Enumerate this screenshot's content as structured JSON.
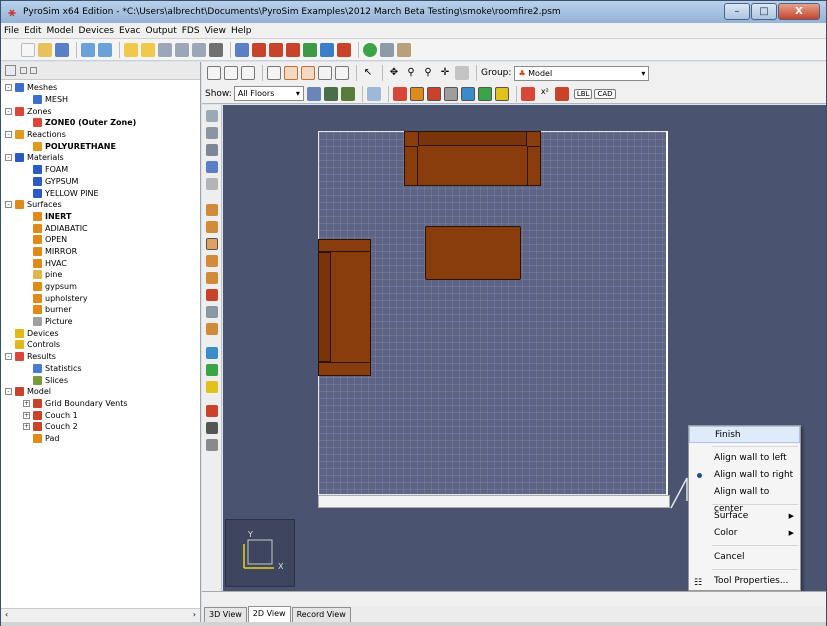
{
  "window": {
    "title": "PyroSim x64 Edition - *C:\\Users\\albrecht\\Documents\\PyroSim Examples\\2012 March Beta Testing\\smoke\\roomfire2.psm",
    "minimize": "–",
    "maximize": "□",
    "close": "X"
  },
  "menu": [
    "File",
    "Edit",
    "Model",
    "Devices",
    "Evac",
    "Output",
    "FDS",
    "View",
    "Help"
  ],
  "toolbar": {
    "group_label": "Group:",
    "group_value": "Model",
    "show_label": "Show:",
    "show_value": "All Floors",
    "lbl_button": "LBL",
    "cad_button": "CAD"
  },
  "tree": [
    {
      "label": "Meshes",
      "indent": 0,
      "toggle": "-",
      "icon_color": "#3b6fc9",
      "bold": false
    },
    {
      "label": "MESH",
      "indent": 1,
      "toggle": "",
      "icon_color": "#3b6fc9",
      "bold": false
    },
    {
      "label": "Zones",
      "indent": 0,
      "toggle": "-",
      "icon_color": "#d9463a",
      "bold": false
    },
    {
      "label": "ZONE0 (Outer Zone)",
      "indent": 1,
      "toggle": "",
      "icon_color": "#d9463a",
      "bold": true
    },
    {
      "label": "Reactions",
      "indent": 0,
      "toggle": "-",
      "icon_color": "#e09a1c",
      "bold": false
    },
    {
      "label": "POLYURETHANE",
      "indent": 1,
      "toggle": "",
      "icon_color": "#e09a1c",
      "bold": true
    },
    {
      "label": "Materials",
      "indent": 0,
      "toggle": "-",
      "icon_color": "#2a5bc2",
      "bold": false
    },
    {
      "label": "FOAM",
      "indent": 1,
      "toggle": "",
      "icon_color": "#2a5bc2",
      "bold": false
    },
    {
      "label": "GYPSUM",
      "indent": 1,
      "toggle": "",
      "icon_color": "#2a5bc2",
      "bold": false
    },
    {
      "label": "YELLOW PINE",
      "indent": 1,
      "toggle": "",
      "icon_color": "#2a5bc2",
      "bold": false
    },
    {
      "label": "Surfaces",
      "indent": 0,
      "toggle": "-",
      "icon_color": "#e08a1a",
      "bold": false
    },
    {
      "label": "INERT",
      "indent": 1,
      "toggle": "",
      "icon_color": "#e08a1a",
      "bold": true
    },
    {
      "label": "ADIABATIC",
      "indent": 1,
      "toggle": "",
      "icon_color": "#e08a1a",
      "bold": false
    },
    {
      "label": "OPEN",
      "indent": 1,
      "toggle": "",
      "icon_color": "#e08a1a",
      "bold": false
    },
    {
      "label": "MIRROR",
      "indent": 1,
      "toggle": "",
      "icon_color": "#e08a1a",
      "bold": false
    },
    {
      "label": "HVAC",
      "indent": 1,
      "toggle": "",
      "icon_color": "#e08a1a",
      "bold": false
    },
    {
      "label": "pine",
      "indent": 1,
      "toggle": "",
      "icon_color": "#e0b84a",
      "bold": false
    },
    {
      "label": "gypsum",
      "indent": 1,
      "toggle": "",
      "icon_color": "#e08a1a",
      "bold": false
    },
    {
      "label": "upholstery",
      "indent": 1,
      "toggle": "",
      "icon_color": "#e08a1a",
      "bold": false
    },
    {
      "label": "burner",
      "indent": 1,
      "toggle": "",
      "icon_color": "#e08a1a",
      "bold": false
    },
    {
      "label": "Picture",
      "indent": 1,
      "toggle": "",
      "icon_color": "#a0a0a0",
      "bold": false
    },
    {
      "label": "Devices",
      "indent": 0,
      "toggle": "",
      "icon_color": "#e0b81a",
      "bold": false
    },
    {
      "label": "Controls",
      "indent": 0,
      "toggle": "",
      "icon_color": "#e0b81a",
      "bold": false
    },
    {
      "label": "Results",
      "indent": 0,
      "toggle": "-",
      "icon_color": "#d9463a",
      "bold": false
    },
    {
      "label": "Statistics",
      "indent": 1,
      "toggle": "",
      "icon_color": "#4a7bd1",
      "bold": false
    },
    {
      "label": "Slices",
      "indent": 1,
      "toggle": "",
      "icon_color": "#7a9a3a",
      "bold": false
    },
    {
      "label": "Model",
      "indent": 0,
      "toggle": "-",
      "icon_color": "#c9422a",
      "bold": false
    },
    {
      "label": "Grid Boundary Vents",
      "indent": 1,
      "toggle": "+",
      "icon_color": "#c9422a",
      "bold": false
    },
    {
      "label": "Couch 1",
      "indent": 1,
      "toggle": "+",
      "icon_color": "#c9422a",
      "bold": false
    },
    {
      "label": "Couch 2",
      "indent": 1,
      "toggle": "+",
      "icon_color": "#c9422a",
      "bold": false
    },
    {
      "label": "Pad",
      "indent": 1,
      "toggle": "",
      "icon_color": "#e08a1a",
      "bold": false
    }
  ],
  "context_menu": {
    "finish": "Finish",
    "align_left": "Align wall to left",
    "align_right": "Align wall to right",
    "align_center": "Align wall to center",
    "surface": "Surface",
    "color": "Color",
    "cancel": "Cancel",
    "tool_properties": "Tool Properties..."
  },
  "axis": {
    "y": "Y",
    "x": "X"
  },
  "tabs": [
    "3D View",
    "2D View",
    "Record View"
  ],
  "active_tab": "2D View",
  "colors": {
    "furniture": "#8a3d0c",
    "grid_bg": "#5d6485",
    "canvas_bg": "#4a5470"
  }
}
